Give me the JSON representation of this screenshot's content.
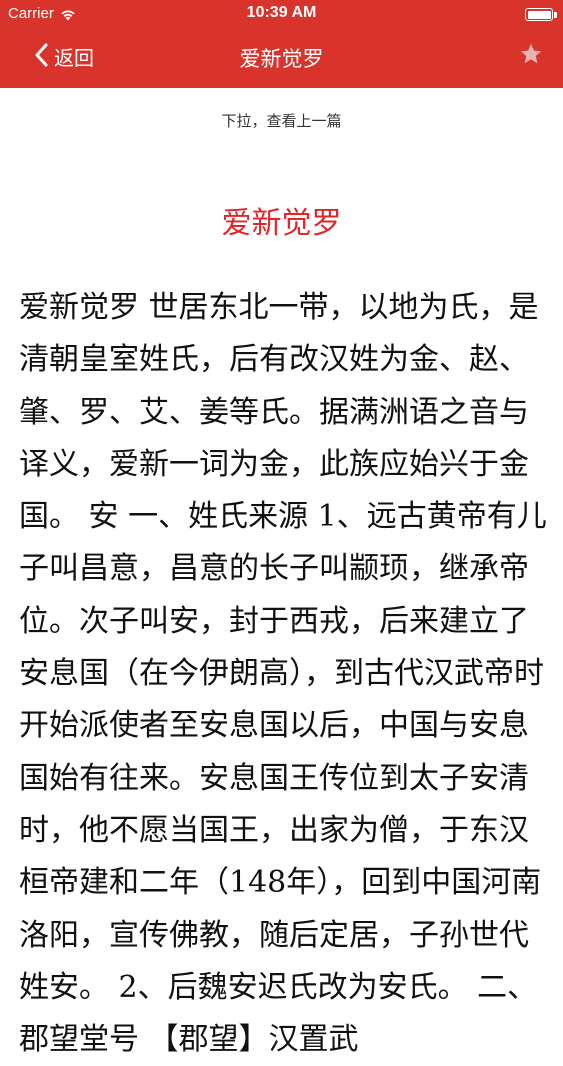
{
  "status": {
    "carrier": "Carrier",
    "time": "10:39 AM",
    "wifi_icon": "wifi-icon",
    "battery_icon": "battery-icon",
    "battery_level": 1.0
  },
  "nav": {
    "back_label": "返回",
    "back_icon": "chevron-left-icon",
    "title": "爱新觉罗",
    "favorite_icon": "star-icon",
    "bar_color": "#d9342b"
  },
  "content": {
    "pull_hint": "下拉，查看上一篇",
    "title": "爱新觉罗",
    "title_color": "#e0262b",
    "body": "爱新觉罗 世居东北一带，以地为氏，是清朝皇室姓氏，后有改汉姓为金、赵、肇、罗、艾、姜等氏。据满洲语之音与译义，爱新一词为金，此族应始兴于金国。 安 一、姓氏来源 1、远古黄帝有儿子叫昌意，昌意的长子叫颛顼，继承帝位。次子叫安，封于西戎，后来建立了安息国（在今伊朗高），到古代汉武帝时开始派使者至安息国以后，中国与安息国始有往来。安息国王传位到太子安清时，他不愿当国王，出家为僧，于东汉桓帝建和二年（148年），回到中国河南洛阳，宣传佛教，随后定居，子孙世代姓安。 2、后魏安迟氏改为安氏。 二、郡望堂号 【郡望】汉置武"
  }
}
